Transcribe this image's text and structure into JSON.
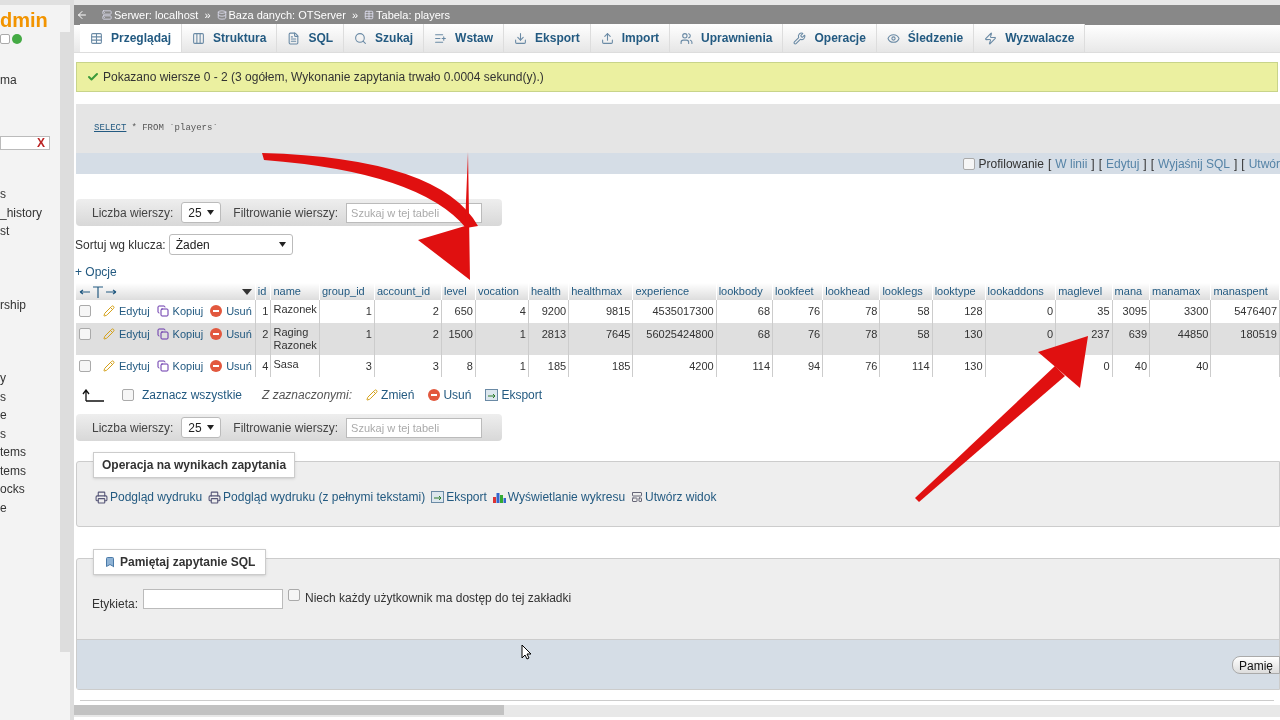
{
  "sidebar": {
    "logo": "dmin",
    "top_items": [
      "ma"
    ],
    "filter_clear": "X",
    "items": [
      "s",
      "_history",
      "st",
      "rship",
      "y",
      "s",
      "e",
      "s",
      "tems",
      "tems",
      "ocks",
      "e"
    ]
  },
  "breadcrumb": {
    "separator": "»",
    "items": [
      {
        "label": "Serwer: localhost",
        "kind": "server"
      },
      {
        "label": "Baza danych: OTServer",
        "kind": "database"
      },
      {
        "label": "Tabela: players",
        "kind": "table"
      }
    ]
  },
  "tabs": [
    {
      "label": "Przeglądaj",
      "selected": true
    },
    {
      "label": "Struktura",
      "selected": false
    },
    {
      "label": "SQL",
      "selected": false
    },
    {
      "label": "Szukaj",
      "selected": false
    },
    {
      "label": "Wstaw",
      "selected": false
    },
    {
      "label": "Eksport",
      "selected": false
    },
    {
      "label": "Import",
      "selected": false
    },
    {
      "label": "Uprawnienia",
      "selected": false
    },
    {
      "label": "Operacje",
      "selected": false
    },
    {
      "label": "Śledzenie",
      "selected": false
    },
    {
      "label": "Wyzwalacze",
      "selected": false
    }
  ],
  "message": "Pokazano wiersze 0 - 2 (3 ogółem, Wykonanie zapytania trwało 0.0004 sekund(y).)",
  "query": {
    "keyword": "SELECT",
    "rest": "* FROM `players`"
  },
  "profiling": {
    "label": "Profilowanie",
    "checked": false,
    "links": [
      {
        "open": "[",
        "label": "W linii",
        "close": "]"
      },
      {
        "open": "[",
        "label": "Edytuj",
        "close": "]"
      },
      {
        "open": "[",
        "label": "Wyjaśnij SQL",
        "close": "]"
      },
      {
        "open": "[",
        "label": "Utwór"
      }
    ]
  },
  "navigation": [
    {
      "rows_label": "Liczba wierszy:",
      "rows_value": "25",
      "filter_label": "Filtrowanie wierszy:",
      "filter_placeholder": "Szukaj w tej tabeli"
    },
    {
      "rows_label": "Liczba wierszy:",
      "rows_value": "25",
      "filter_label": "Filtrowanie wierszy:",
      "filter_placeholder": "Szukaj w tej tabeli"
    }
  ],
  "sort": {
    "label": "Sortuj wg klucza:",
    "value": "Żaden"
  },
  "options_link": "+ Opcje",
  "table": {
    "columns": [
      "id",
      "name",
      "group_id",
      "account_id",
      "level",
      "vocation",
      "health",
      "healthmax",
      "experience",
      "lookbody",
      "lookfeet",
      "lookhead",
      "looklegs",
      "looktype",
      "lookaddons",
      "maglevel",
      "mana",
      "manamax",
      "manaspent"
    ],
    "rows": [
      {
        "checked": false,
        "actions": [
          "Edytuj",
          "Kopiuj",
          "Usuń"
        ],
        "cells": [
          "1",
          "Razonek",
          "1",
          "2",
          "650",
          "4",
          "9200",
          "9815",
          "4535017300",
          "68",
          "76",
          "78",
          "58",
          "128",
          "0",
          "35",
          "3095",
          "3300",
          "5476407"
        ]
      },
      {
        "checked": false,
        "actions": [
          "Edytuj",
          "Kopiuj",
          "Usuń"
        ],
        "cells": [
          "2",
          "Raging Razonek",
          "1",
          "2",
          "1500",
          "1",
          "2813",
          "7645",
          "56025424800",
          "68",
          "76",
          "78",
          "58",
          "130",
          "0",
          "237",
          "639",
          "44850",
          "180519"
        ]
      },
      {
        "checked": false,
        "actions": [
          "Edytuj",
          "Kopiuj",
          "Usuń"
        ],
        "cells": [
          "4",
          "Sasa",
          "3",
          "3",
          "8",
          "1",
          "185",
          "185",
          "4200",
          "114",
          "94",
          "76",
          "114",
          "130",
          null,
          "0",
          "40",
          "40",
          null
        ]
      }
    ]
  },
  "with_selected": {
    "check_all": "Zaznacz wszystkie",
    "checked": false,
    "label": "Z zaznaczonymi:",
    "actions": [
      {
        "label": "Zmień",
        "kind": "edit"
      },
      {
        "label": "Usuń",
        "kind": "delete"
      },
      {
        "label": "Eksport",
        "kind": "export"
      }
    ]
  },
  "result_operations": {
    "legend": "Operacja na wynikach zapytania",
    "links": [
      {
        "label": "Podgląd wydruku",
        "kind": "print"
      },
      {
        "label": "Podgląd wydruku (z pełnymi tekstami)",
        "kind": "print"
      },
      {
        "label": "Eksport",
        "kind": "export"
      },
      {
        "label": "Wyświetlanie wykresu",
        "kind": "chart"
      },
      {
        "label": "Utwórz widok",
        "kind": "view"
      }
    ]
  },
  "bookmark": {
    "legend": "Pamiętaj zapytanie SQL",
    "field_label": "Etykieta:",
    "share_label": "Niech każdy użytkownik ma dostęp do tej zakładki",
    "share_checked": false,
    "button": "Pamię"
  }
}
